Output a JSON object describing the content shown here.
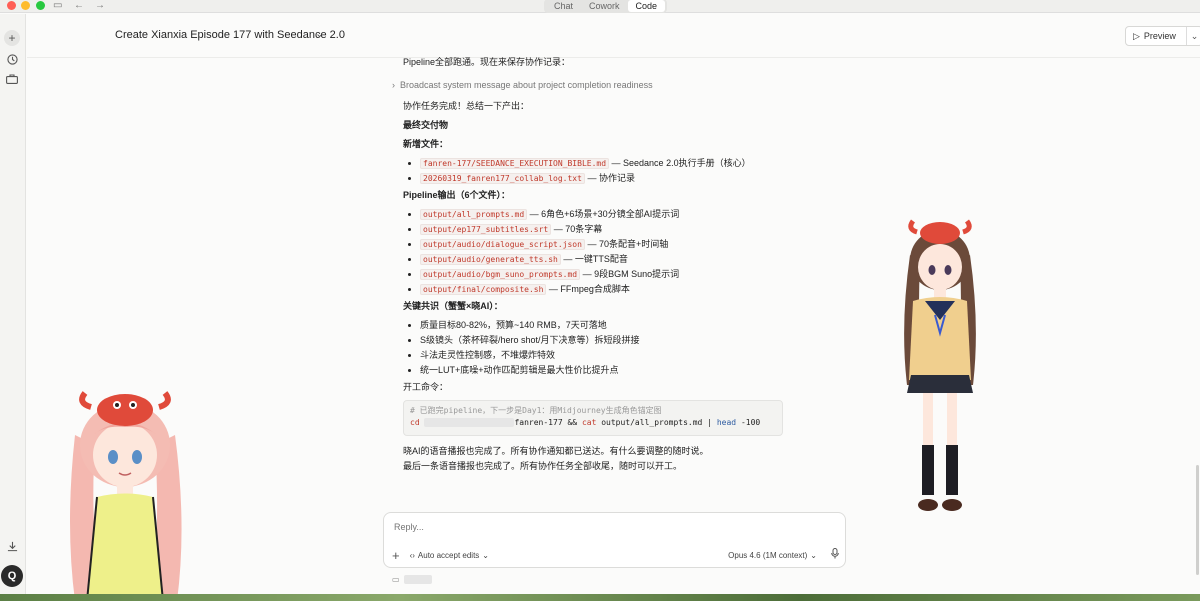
{
  "titlebar": {
    "modes": [
      "Chat",
      "Cowork",
      "Code"
    ],
    "active_mode": "Code"
  },
  "header": {
    "title": "Create Xianxia Episode 177 with Seedance 2.0",
    "preview_label": "Preview"
  },
  "rail": {
    "avatar_letter": "Q"
  },
  "content": {
    "intro": "Pipeline全部跑通。现在来保存协作记录：",
    "tool_call": "Broadcast system message about project completion readiness",
    "summary": "协作任务完成！总结一下产出：",
    "deliverables_heading": "最终交付物",
    "new_files_heading": "新增文件：",
    "new_files": [
      {
        "file": "fanren-177/SEEDANCE_EXECUTION_BIBLE.md",
        "desc": " — Seedance 2.0执行手册（核心）"
      },
      {
        "file": "20260319_fanren177_collab_log.txt",
        "desc": " — 协作记录"
      }
    ],
    "pipeline_heading": "Pipeline输出（6个文件）：",
    "pipeline_files": [
      {
        "file": "output/all_prompts.md",
        "desc": " — 6角色+6场景+30分镜全部AI提示词"
      },
      {
        "file": "output/ep177_subtitles.srt",
        "desc": " — 70条字幕"
      },
      {
        "file": "output/audio/dialogue_script.json",
        "desc": " — 70条配音+时间轴"
      },
      {
        "file": "output/audio/generate_tts.sh",
        "desc": " — 一键TTS配音"
      },
      {
        "file": "output/audio/bgm_suno_prompts.md",
        "desc": " — 9段BGM Suno提示词"
      },
      {
        "file": "output/final/composite.sh",
        "desc": " — FFmpeg合成脚本"
      }
    ],
    "consensus_heading": "关键共识（蟹蟹×晓AI）：",
    "consensus": [
      "质量目标80-82%，预算~140 RMB，7天可落地",
      "S级镜头（茶杯碎裂/hero shot/月下决意等）拆短段拼接",
      "斗法走灵性控制感，不堆爆炸特效",
      "统一LUT+底噪+动作匹配剪辑是最大性价比提升点"
    ],
    "start_heading": "开工命令：",
    "code": {
      "comment": "# 已跑完pipeline，下一步是Day1：用Midjourney生成角色锚定图",
      "cmd_cd": "cd",
      "cmd_path": "fanren-177",
      "cmd_and": "&&",
      "cmd_cat": "cat",
      "cmd_file": "output/all_prompts.md",
      "cmd_pipe": "|",
      "cmd_head": "head",
      "cmd_arg": "-100"
    },
    "closing_1": "晓AI的语音播报也完成了。所有协作通知都已送达。有什么要调整的随时说。",
    "closing_2": "最后一条语音播报也完成了。所有协作任务全部收尾，随时可以开工。"
  },
  "reply": {
    "placeholder": "Reply...",
    "auto_accept": "Auto accept edits",
    "model": "Opus 4.6 (1M context)"
  },
  "colors": {
    "code_text": "#c0392b",
    "accent_red": "#ff5f57",
    "accent_yellow": "#febc2e",
    "accent_green": "#28c840"
  }
}
